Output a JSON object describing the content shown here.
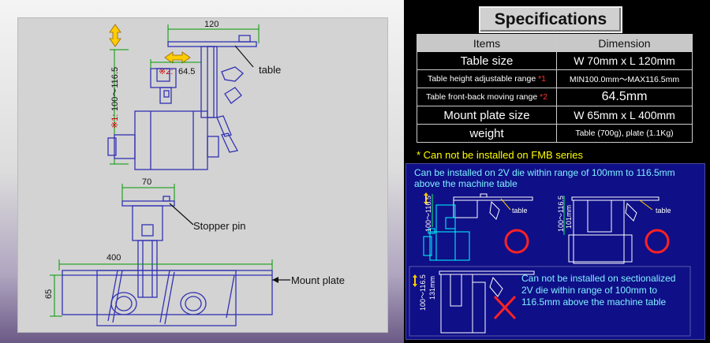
{
  "drawing": {
    "dim_120": "120",
    "label_table": "table",
    "dim_1_mark": "※1:",
    "dim_1_text": "100～116.5",
    "dim_2_mark": "※2:",
    "dim_2_text": "64.5",
    "dim_70": "70",
    "label_stopper": "Stopper pin",
    "dim_400": "400",
    "dim_65": "65",
    "label_mount": "Mount plate"
  },
  "specs": {
    "title": "Specifications",
    "header": [
      "Items",
      "Dimension"
    ],
    "rows": [
      {
        "item": "Table size",
        "value": "W 70mm  x  L 120mm"
      },
      {
        "item": "Table height adjustable range",
        "mark": "*1",
        "value": "MIN100.0mm～MAX116.5mm"
      },
      {
        "item": "Table front-back moving range",
        "mark": "*2",
        "value": "64.5mm"
      },
      {
        "item": "Mount plate size",
        "value": "W 65mm  x  L 400mm"
      },
      {
        "item": "weight",
        "value": "Table (700g), plate (1.1Kg)"
      }
    ],
    "note": "* Can not be installed on FMB series"
  },
  "install": {
    "ok_text_1": "Can be installed on 2V die within range of 100mm to 116.5mm",
    "ok_text_2": "above the machine table",
    "fig1_dim": "100～116.5",
    "fig1_label": "table",
    "fig2_dim_a": "100～116.5",
    "fig2_dim_b": "101mm",
    "fig2_label": "table",
    "ng_dim_a": "100～116.5",
    "ng_dim_b": "131mm",
    "ng_text_1": "Can not be installed on sectionalized",
    "ng_text_2": "2V die within range of 100mm to",
    "ng_text_3": "116.5mm above the machine table"
  },
  "colors": {
    "blueprint": "#3232b4",
    "dimension": "#009900",
    "arrow": "#ffcc00",
    "ok": "#ff2222",
    "ng": "#ff2222"
  }
}
